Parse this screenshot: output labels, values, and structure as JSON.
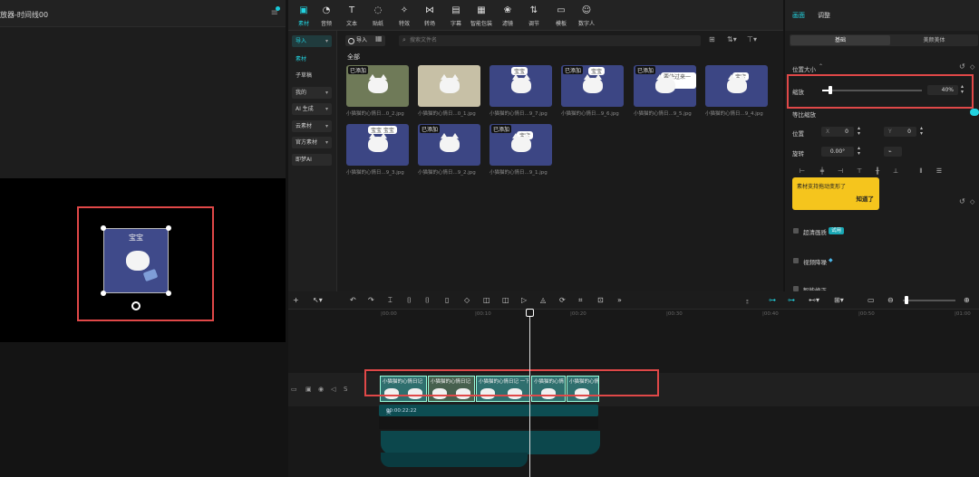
{
  "player": {
    "title": "放器-时间线00",
    "menu_icon": "hamburger-icon",
    "canvas_caption": "宝宝",
    "selection_color": "#e04848"
  },
  "toolbar": {
    "tabs": [
      {
        "label": "素材",
        "icon": "media-icon",
        "active": true
      },
      {
        "label": "音频",
        "icon": "audio-icon"
      },
      {
        "label": "文本",
        "icon": "text-icon"
      },
      {
        "label": "贴纸",
        "icon": "sticker-icon"
      },
      {
        "label": "特效",
        "icon": "effects-icon"
      },
      {
        "label": "转场",
        "icon": "transition-icon"
      },
      {
        "label": "字幕",
        "icon": "caption-icon"
      },
      {
        "label": "智能包装",
        "icon": "smart-pack-icon"
      },
      {
        "label": "滤镜",
        "icon": "filter-icon"
      },
      {
        "label": "调节",
        "icon": "adjust-icon"
      },
      {
        "label": "模板",
        "icon": "template-icon"
      },
      {
        "label": "数字人",
        "icon": "avatar-icon"
      }
    ]
  },
  "media": {
    "sidebar": [
      "导入",
      "素材",
      "子草稿",
      "我的",
      "AI 生成",
      "云素材",
      "官方素材",
      "即梦AI"
    ],
    "import_label": "导入",
    "search_placeholder": "搜索文件名",
    "section_title": "全部",
    "items": [
      {
        "name": "小猫猫的心情日...0_2.jpg",
        "badge": "已添加",
        "bubble": "",
        "style": "green"
      },
      {
        "name": "小猫猫的心情日...0_1.jpg",
        "badge": "",
        "bubble": "",
        "style": "field"
      },
      {
        "name": "小猫猫的心情日...9_7.jpg",
        "badge": "",
        "bubble": "宝宝",
        "style": "blue"
      },
      {
        "name": "小猫猫的心情日...9_6.jpg",
        "badge": "已添加",
        "bubble": "宝宝",
        "style": "blue"
      },
      {
        "name": "小猫猫的心情日...9_5.jpg",
        "badge": "已添加",
        "bubble": "要快过来一下",
        "style": "blue"
      },
      {
        "name": "小猫猫的心情日...9_4.jpg",
        "badge": "",
        "bubble": "宝宝",
        "style": "blue"
      },
      {
        "name": "小猫猫的心情日...9_3.jpg",
        "badge": "",
        "bubble": "宝宝 宝宝",
        "style": "blue"
      },
      {
        "name": "小猫猫的心情日...9_2.jpg",
        "badge": "已添加",
        "bubble": "",
        "style": "blue"
      },
      {
        "name": "小猫猫的心情日...9_1.jpg",
        "badge": "已添加",
        "bubble": "宝宝",
        "style": "blue"
      }
    ]
  },
  "props": {
    "tabs": [
      "画面",
      "调整"
    ],
    "sub_tabs": [
      "基础",
      "美颜美体"
    ],
    "section_position_size": "位置大小",
    "scale_label": "缩放",
    "scale_value": "40%",
    "scale_fraction": 0.4,
    "uniform_scale_label": "等比缩放",
    "position_label": "位置",
    "pos_x_label": "X",
    "pos_x": "0",
    "pos_y_label": "Y",
    "pos_y": "0",
    "rotation_label": "旋转",
    "rotation_value": "0.00°",
    "tooltip_text": "素材支持拖动变形了",
    "tooltip_action": "知道了",
    "hd_label": "超清画质",
    "hd_tag": "试用",
    "denoise_label": "视频降噪",
    "bottom_label": "智能修正",
    "accent_color": "#22d3e0"
  },
  "timeline": {
    "ruler": [
      "|00:00",
      "|00:10",
      "|00:20",
      "|00:30",
      "|00:40",
      "|00:50",
      "|01:00"
    ],
    "clips": [
      {
        "label": "小猫猫的心情日记"
      },
      {
        "label": "小猫猫的心情日记"
      },
      {
        "label": "小猫猫的心情日记 一下"
      },
      {
        "label": "小猫猫的心情日记"
      },
      {
        "label": "小猫猫的心情日记"
      }
    ],
    "audio_label": "奥德",
    "audio_time": "00:00:22:22",
    "track_icons": [
      "add-track-icon",
      "lock-icon",
      "eye-icon",
      "volume-icon",
      "s-icon"
    ]
  }
}
